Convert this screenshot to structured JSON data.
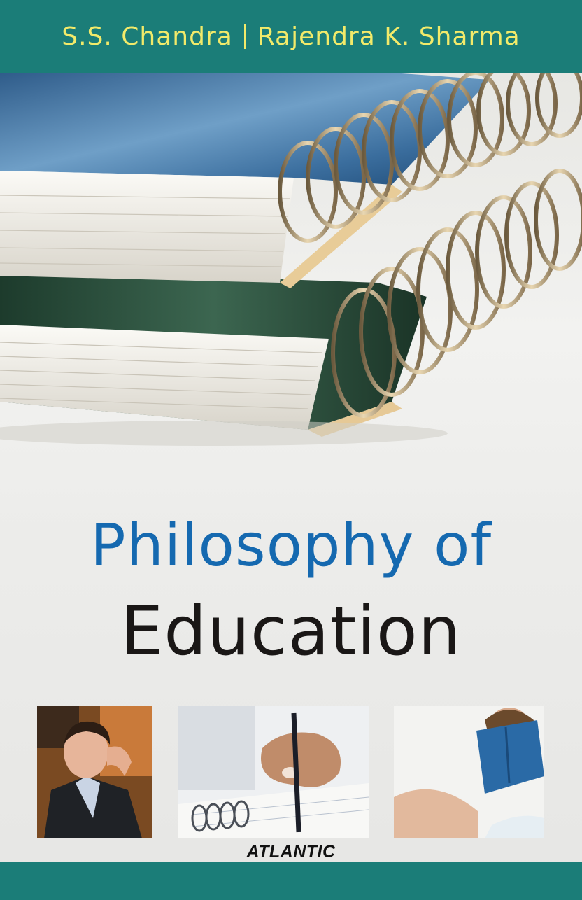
{
  "authors": {
    "first": "S.S. Chandra",
    "second": "Rajendra K. Sharma"
  },
  "title": {
    "line1": "Philosophy of",
    "line2": "Education"
  },
  "publisher": "ATLANTIC",
  "colors": {
    "band": "#1b7d78",
    "author_text": "#f2ea6a",
    "title_blue": "#1569b0",
    "title_dark": "#1a1716"
  },
  "images": {
    "hero": "spiral-notebooks-photo",
    "photo1": "student-thinking-photo",
    "photo2": "hand-writing-with-pen-photo",
    "photo3": "girl-reading-book-photo"
  }
}
